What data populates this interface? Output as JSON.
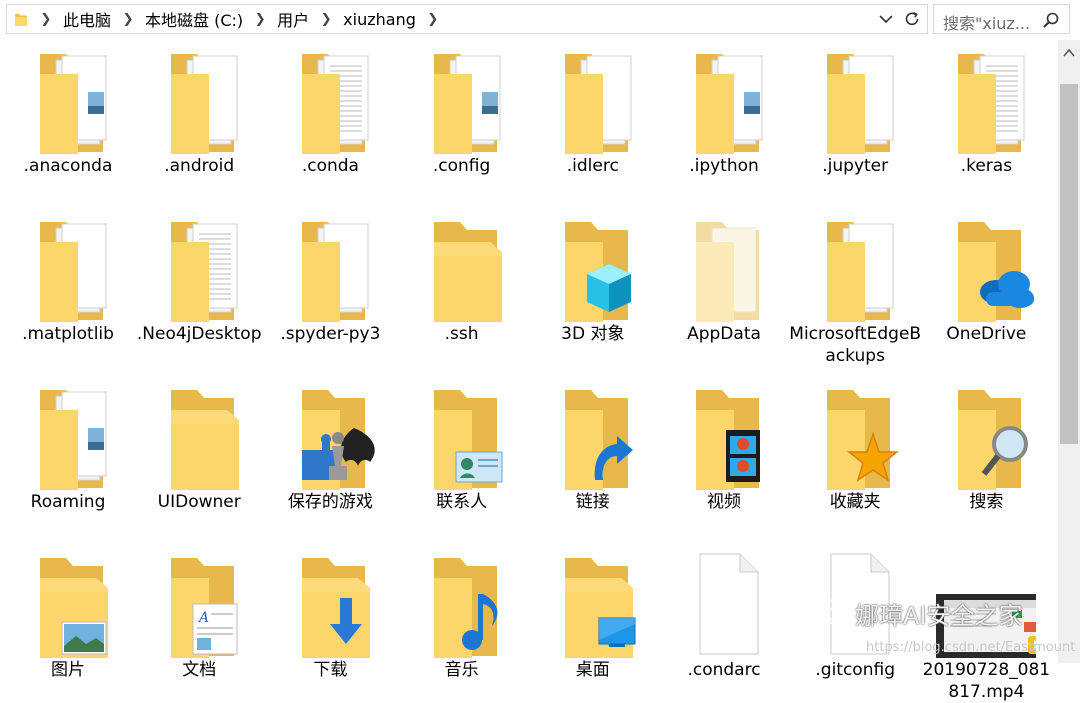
{
  "address_bar": {
    "breadcrumbs": [
      "此电脑",
      "本地磁盘 (C:)",
      "用户",
      "xiuzhang"
    ]
  },
  "search": {
    "placeholder": "搜索\"xiuz..."
  },
  "icons": {
    "address_folder": "folder-icon",
    "dropdown": "chevron-down-icon",
    "refresh": "refresh-icon",
    "search": "search-icon",
    "scroll_up": "chevron-up-icon"
  },
  "items": [
    {
      "label": ".anaconda",
      "kind": "folder-docs-image"
    },
    {
      "label": ".android",
      "kind": "folder-docs"
    },
    {
      "label": ".conda",
      "kind": "folder-docs-text"
    },
    {
      "label": ".config",
      "kind": "folder-docs-image"
    },
    {
      "label": ".idlerc",
      "kind": "folder-docs"
    },
    {
      "label": ".ipython",
      "kind": "folder-docs-image"
    },
    {
      "label": ".jupyter",
      "kind": "folder-docs"
    },
    {
      "label": ".keras",
      "kind": "folder-docs-text"
    },
    {
      "label": ".matplotlib",
      "kind": "folder-docs"
    },
    {
      "label": ".Neo4jDesktop",
      "kind": "folder-docs-text"
    },
    {
      "label": ".spyder-py3",
      "kind": "folder-docs"
    },
    {
      "label": ".ssh",
      "kind": "folder-empty"
    },
    {
      "label": "3D 对象",
      "kind": "folder-3d"
    },
    {
      "label": "AppData",
      "kind": "folder-faded"
    },
    {
      "label": "MicrosoftEdgeBackups",
      "kind": "folder-docs"
    },
    {
      "label": "OneDrive",
      "kind": "folder-onedrive"
    },
    {
      "label": "Roaming",
      "kind": "folder-docs-image"
    },
    {
      "label": "UIDowner",
      "kind": "folder-empty"
    },
    {
      "label": "保存的游戏",
      "kind": "folder-games"
    },
    {
      "label": "联系人",
      "kind": "folder-contacts"
    },
    {
      "label": "链接",
      "kind": "folder-links"
    },
    {
      "label": "视频",
      "kind": "folder-videos"
    },
    {
      "label": "收藏夹",
      "kind": "folder-favorites"
    },
    {
      "label": "搜索",
      "kind": "folder-searches"
    },
    {
      "label": "图片",
      "kind": "folder-pictures"
    },
    {
      "label": "文档",
      "kind": "folder-documents"
    },
    {
      "label": "下载",
      "kind": "folder-downloads"
    },
    {
      "label": "音乐",
      "kind": "folder-music"
    },
    {
      "label": "桌面",
      "kind": "folder-desktop"
    },
    {
      "label": ".condarc",
      "kind": "file-blank"
    },
    {
      "label": ".gitconfig",
      "kind": "file-blank"
    },
    {
      "label": "20190728_081817.mp4",
      "kind": "file-video"
    }
  ],
  "watermark": {
    "text": "娜璋AI安全之家",
    "url": "https://blog.csdn.net/Eastmount"
  }
}
